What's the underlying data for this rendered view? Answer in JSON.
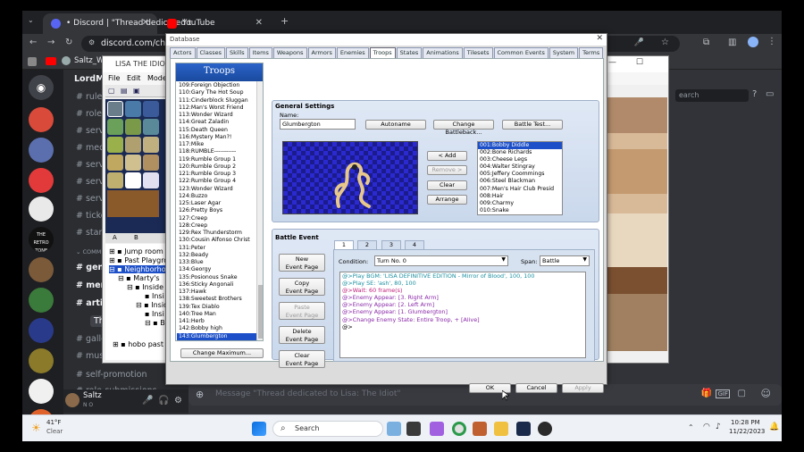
{
  "chrome": {
    "tabs": [
      {
        "title": "• Discord | \"Thread dedicated t",
        "active": true
      },
      {
        "title": "YouTube",
        "active": false
      }
    ],
    "url": "discord.com/channels",
    "bookmark": "Saltz_Wuz",
    "new_tab_glyph": "+",
    "close_glyph": "✕"
  },
  "discord": {
    "server_name": "LordM",
    "channels": [
      "rules-a",
      "roles-a",
      "server-",
      "media-",
      "server-",
      "server-",
      "server-",
      "ticket-",
      "starbo"
    ],
    "category": "COMMUN",
    "channels2": [
      "genera",
      "memes",
      "artist-r"
    ],
    "thread": "Thread",
    "channels3": [
      "gallery",
      "music-",
      "self-promotion",
      "role-submissions"
    ],
    "message_placeholder": "Message \"Thread dedicated to Lisa: The Idiot\"",
    "user": {
      "name": "Saltz",
      "status": "N O"
    },
    "servers": [
      "",
      "",
      "",
      "",
      "THE RETRO ZONE",
      "",
      "",
      "",
      "",
      ""
    ],
    "search_placeholder": "earch"
  },
  "editor": {
    "title": "LISA THE IDIOT - R",
    "menu": [
      "File",
      "Edit",
      "Mode",
      "D"
    ],
    "tileset_tabs": [
      "A",
      "B"
    ],
    "map_tree": [
      "Jump room",
      "Past Playgrou",
      "Neighborho",
      "Marty's",
      "Inside",
      "Insi",
      "Inside",
      "Insi",
      "B",
      "hobo past"
    ]
  },
  "database": {
    "title": "Database",
    "tabs": [
      "Actors",
      "Classes",
      "Skills",
      "Items",
      "Weapons",
      "Armors",
      "Enemies",
      "Troops",
      "States",
      "Animations",
      "Tilesets",
      "Common Events",
      "System",
      "Terms"
    ],
    "active_tab": "Troops",
    "list_title": "Troops",
    "troops": [
      "109:Foreign Objection",
      "110:Gary The Hot Soup",
      "111:Cinderblock Sluggan",
      "112:Man's Worst Friend",
      "113:Wonder Wizard",
      "114:Great Zaladin",
      "115:Death Queen",
      "116:Mystery Man?!",
      "117:Mike",
      "118:RUMBLE-----------",
      "119:Rumble Group 1",
      "120:Rumble Group 2",
      "121:Rumble Group 3",
      "122:Rumble Group 4",
      "123:Wonder Wizard",
      "124:Buzzo",
      "125:Laser Agar",
      "126:Pretty Boys",
      "127:Creep",
      "128:Creep",
      "129:Rex Thunderstorm",
      "130:Cousin Alfonso Christ",
      "131:Peter",
      "132:Beady",
      "133:Blue",
      "134:Georgy",
      "135:Posionous Snake",
      "136:Sticky Angonali",
      "137:Hawk",
      "138:Sweetest Brothers",
      "139:Tex Diablo",
      "140:Tree Man",
      "141:Herb",
      "142:Bobby high",
      "143:Glumbergton"
    ],
    "selected_troop": "143:Glumbergton",
    "change_max": "Change Maximum...",
    "general": {
      "title": "General Settings",
      "name_label": "Name:",
      "name_value": "Glumbergton",
      "autoname": "Autoname",
      "change_battleback": "Change Battleback...",
      "battle_test": "Battle Test...",
      "add": "< Add",
      "remove": "Remove >",
      "clear": "Clear",
      "arrange": "Arrange"
    },
    "enemies": [
      "001:Bobby Diddle",
      "002:Bone Richards",
      "003:Cheese Legs",
      "004:Walter Stingray",
      "005:Jeffery Coommings",
      "006:Steel Blackman",
      "007:Men's Hair Club Presid",
      "008:Hair",
      "009:Charmy",
      "010:Snake"
    ],
    "selected_enemy": "001:Bobby Diddle",
    "battle_event": {
      "title": "Battle Event",
      "buttons": [
        "New\nEvent Page",
        "Copy\nEvent Page",
        "Paste\nEvent Page",
        "Delete\nEvent Page",
        "Clear\nEvent Page"
      ],
      "page_tabs": [
        "1",
        "2",
        "3",
        "4"
      ],
      "condition_label": "Condition:",
      "condition_value": "Turn No. 0",
      "span_label": "Span:",
      "span_value": "Battle",
      "commands": [
        {
          "text": "@>Play BGM: 'LISA DEFINITIVE EDITION - Mirror of Blood', 100, 100",
          "color": "#1a8fa0"
        },
        {
          "text": "@>Play SE: 'ash', 80, 100",
          "color": "#1a8fa0"
        },
        {
          "text": "@>Wait: 60 frame(s)",
          "color": "#c0207a"
        },
        {
          "text": "@>Enemy Appear: [3. Right Arm]",
          "color": "#8a2aa8"
        },
        {
          "text": "@>Enemy Appear: [2. Left Arm]",
          "color": "#8a2aa8"
        },
        {
          "text": "@>Enemy Appear: [1. Glumbergton]",
          "color": "#8a2aa8"
        },
        {
          "text": "@>Change Enemy State: Entire Troop, + [Alive]",
          "color": "#8a2aa8"
        },
        {
          "text": "@>",
          "color": "#000000"
        }
      ]
    },
    "ok": "OK",
    "cancel": "Cancel",
    "apply": "Apply"
  },
  "taskbar": {
    "weather_temp": "41°F",
    "weather_desc": "Clear",
    "search": "Search",
    "time": "10:28 PM",
    "date": "11/22/2023"
  }
}
